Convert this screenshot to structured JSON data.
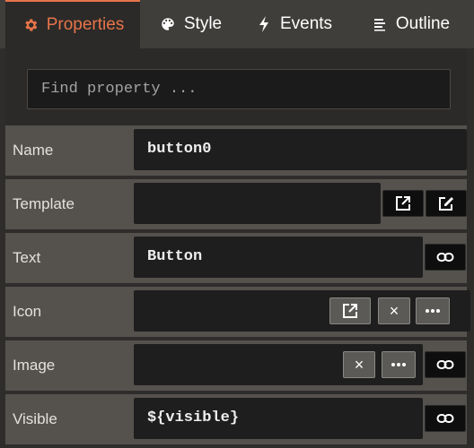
{
  "tabs": [
    {
      "label": "Properties",
      "icon": "gear-icon",
      "active": true
    },
    {
      "label": "Style",
      "icon": "palette-icon",
      "active": false
    },
    {
      "label": "Events",
      "icon": "lightning-icon",
      "active": false
    },
    {
      "label": "Outline",
      "icon": "list-icon",
      "active": false
    }
  ],
  "search": {
    "placeholder": "Find property ...",
    "value": ""
  },
  "properties": [
    {
      "label": "Name",
      "value": "button0"
    },
    {
      "label": "Template",
      "value": ""
    },
    {
      "label": "Text",
      "value": "Button"
    },
    {
      "label": "Icon",
      "value": ""
    },
    {
      "label": "Image",
      "value": ""
    },
    {
      "label": "Visible",
      "value": "${visible}"
    }
  ],
  "icons": {
    "open_external": "open-external-icon",
    "edit": "edit-icon",
    "link": "link-icon",
    "clear": "×",
    "more": "more-icon"
  },
  "colors": {
    "accent": "#e8744a",
    "tab_bar": "#403e3b",
    "row_bg": "#55524e",
    "field_bg": "#1e1e1e"
  }
}
